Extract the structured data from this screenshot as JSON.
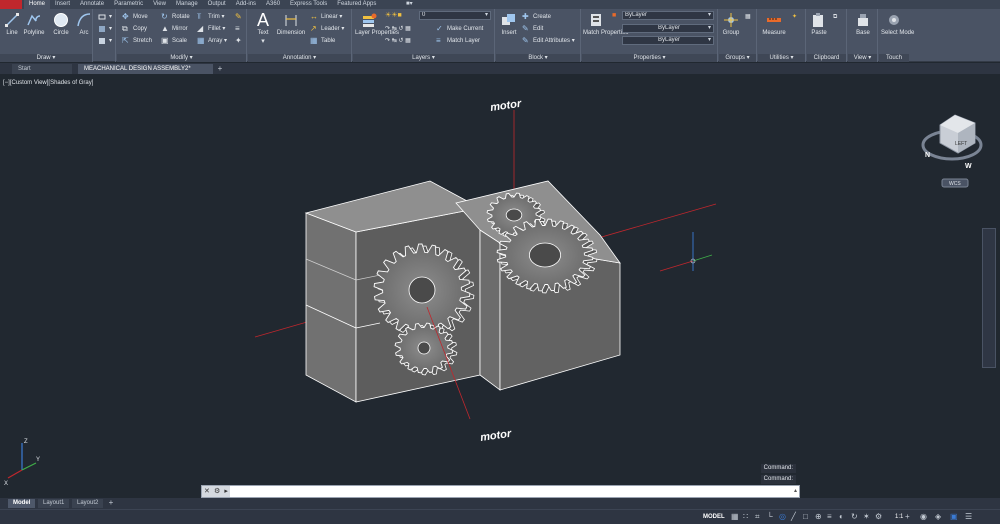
{
  "ribbon_tabs": [
    "Home",
    "Insert",
    "Annotate",
    "Parametric",
    "View",
    "Manage",
    "Output",
    "Add-ins",
    "A360",
    "Express Tools",
    "Featured Apps"
  ],
  "active_tab": "Home",
  "draw": {
    "title": "Draw",
    "line": "Line",
    "polyline": "Polyline",
    "circle": "Circle",
    "arc": "Arc"
  },
  "modify": {
    "title": "Modify",
    "move": "Move",
    "rotate": "Rotate",
    "trim": "Trim",
    "copy": "Copy",
    "mirror": "Mirror",
    "fillet": "Fillet",
    "stretch": "Stretch",
    "scale": "Scale",
    "array": "Array"
  },
  "annotation": {
    "title": "Annotation",
    "text": "Text",
    "dimension": "Dimension",
    "linear": "Linear",
    "leader": "Leader",
    "table": "Table"
  },
  "layers": {
    "title": "Layers",
    "layer_properties": "Layer Properties",
    "current_layer": "0",
    "make_current": "Make Current",
    "match_layer": "Match Layer"
  },
  "block": {
    "title": "Block",
    "insert": "Insert",
    "create": "Create",
    "edit": "Edit",
    "edit_attributes": "Edit Attributes"
  },
  "properties": {
    "title": "Properties",
    "match_properties": "Match Properties",
    "color": "ByLayer",
    "linetype": "ByLayer",
    "lineweight": "ByLayer"
  },
  "groups": {
    "title": "Groups",
    "group": "Group"
  },
  "utilities": {
    "title": "Utilities",
    "measure": "Measure"
  },
  "clipboard": {
    "title": "Clipboard",
    "paste": "Paste"
  },
  "view_panel": {
    "title": "View",
    "base": "Base"
  },
  "touch": {
    "title": "Touch",
    "select_mode": "Select Mode"
  },
  "doc_tabs": [
    "Start",
    "MEACHANICAL DESIGN ASSEMBLY2*"
  ],
  "active_doc": "MEACHANICAL DESIGN ASSEMBLY2*",
  "viewport_label": "[−][Custom View][Shades of Gray]",
  "annotations": [
    "motor",
    "motor"
  ],
  "viewcube": {
    "face": "LEFT",
    "north": "N",
    "west": "W",
    "wcs": "WCS"
  },
  "command_history": [
    "Command:",
    "Command:"
  ],
  "command_placeholder": "",
  "layout_tabs": [
    "Model",
    "Layout1",
    "Layout2"
  ],
  "status": {
    "model": "MODEL",
    "scale": "1:1"
  },
  "colors": {
    "app_red": "#c0272d",
    "ribbon": "#4a5364",
    "background": "#212830",
    "axis_red": "#c0272d",
    "axis_green": "#3fae49",
    "axis_blue": "#3a7bd5"
  }
}
